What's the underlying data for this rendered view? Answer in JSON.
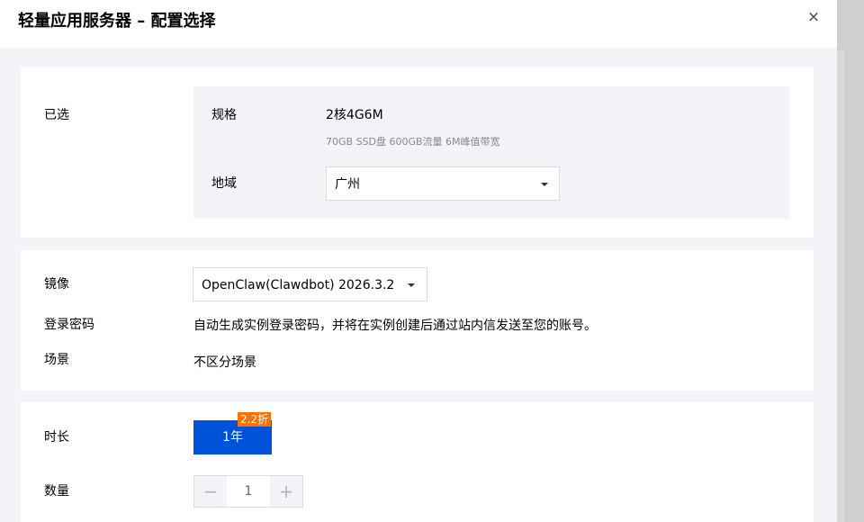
{
  "dialog": {
    "title": "轻量应用服务器 – 配置选择",
    "close_label": "×"
  },
  "selected": {
    "label": "已选",
    "spec_label": "规格",
    "spec_value": "2核4G6M",
    "spec_detail": "70GB SSD盘 600GB流量 6M峰值带宽",
    "region_label": "地域",
    "region_value": "广州"
  },
  "image": {
    "label": "镜像",
    "value": "OpenClaw(Clawdbot) 2026.3.2"
  },
  "password": {
    "label": "登录密码",
    "value": "自动生成实例登录密码，并将在实例创建后通过站内信发送至您的账号。"
  },
  "scene": {
    "label": "场景",
    "value": "不区分场景"
  },
  "duration": {
    "label": "时长",
    "option": "1年",
    "badge": "2.2折"
  },
  "quantity": {
    "label": "数量",
    "minus": "−",
    "value": "1",
    "plus": "+"
  },
  "colors": {
    "primary": "#0052d9",
    "badge": "#ff7200",
    "panel_bg": "#f3f4f7"
  }
}
